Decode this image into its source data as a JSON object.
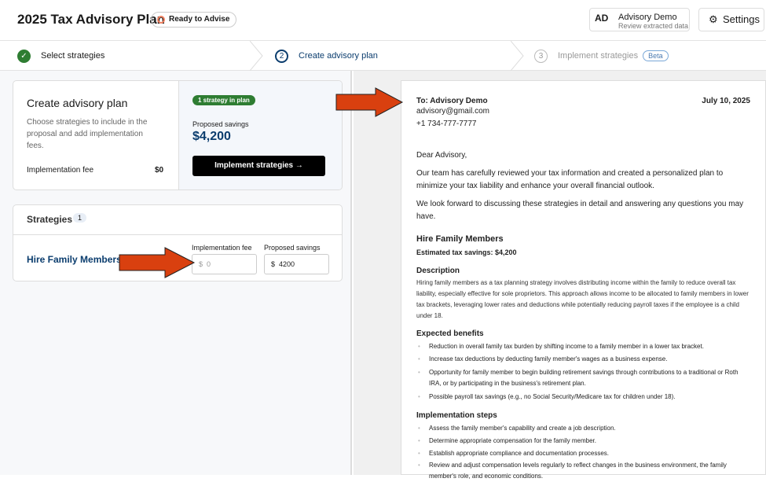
{
  "header": {
    "title": "2025 Tax Advisory Plan",
    "status": "Ready to Advise",
    "user_initials": "AD",
    "user_name": "Advisory Demo",
    "user_sub": "Review extracted data",
    "settings": "Settings"
  },
  "steps": [
    {
      "num": "1",
      "label": "Select strategies"
    },
    {
      "num": "2",
      "label": "Create advisory plan"
    },
    {
      "num": "3",
      "label": "Implement strategies",
      "badge": "Beta"
    }
  ],
  "plan": {
    "title": "Create advisory plan",
    "desc": "Choose strategies to include in the proposal and add implementation fees.",
    "fee_label": "Implementation fee",
    "fee_value": "$0",
    "count_badge": "1 strategy in plan",
    "savings_label": "Proposed savings",
    "savings_value": "$4,200",
    "implement_button": "Implement strategies"
  },
  "strategies": {
    "title": "Strategies",
    "count": "1",
    "name": "Hire Family Members",
    "fee_label": "Implementation fee",
    "savings_label": "Proposed savings",
    "currency": "$",
    "fee_placeholder": "0",
    "savings_value": "4200"
  },
  "doc": {
    "to": "To: Advisory Demo",
    "date": "July 10, 2025",
    "email": "advisory@gmail.com",
    "phone": "+1 734-777-7777",
    "greeting": "Dear Advisory,",
    "p1": "Our team has carefully reviewed your tax information and created a personalized plan to minimize your tax liability and enhance your overall financial outlook.",
    "p2": "We look forward to discussing these strategies in detail and answering any questions you may have.",
    "strategy": "Hire Family Members",
    "est": "Estimated tax savings: $4,200",
    "desc_h": "Description",
    "desc": "Hiring family members as a tax planning strategy involves distributing income within the family to reduce overall tax liability, especially effective for sole proprietors. This approach allows income to be allocated to family members in lower tax brackets, leveraging lower rates and deductions while potentially reducing payroll taxes if the employee is a child under 18.",
    "benefits_h": "Expected benefits",
    "benefits": [
      "Reduction in overall family tax burden by shifting income to a family member in a lower tax bracket.",
      "Increase tax deductions by deducting family member's wages as a business expense.",
      "Opportunity for family member to begin building retirement savings through contributions to a traditional or Roth IRA, or by participating in the business's retirement plan.",
      "Possible payroll tax savings (e.g., no Social Security/Medicare tax for children under 18)."
    ],
    "steps_h": "Implementation steps",
    "steps": [
      "Assess the family member's capability and create a job description.",
      "Determine appropriate compensation for the family member.",
      "Establish appropriate compliance and documentation processes.",
      "Review and adjust compensation levels regularly to reflect changes in the business environment, the family member's role, and economic conditions."
    ]
  },
  "colors": {
    "accent": "#0b3d6e",
    "success": "#2e7d32",
    "arrow": "#d9400f"
  }
}
